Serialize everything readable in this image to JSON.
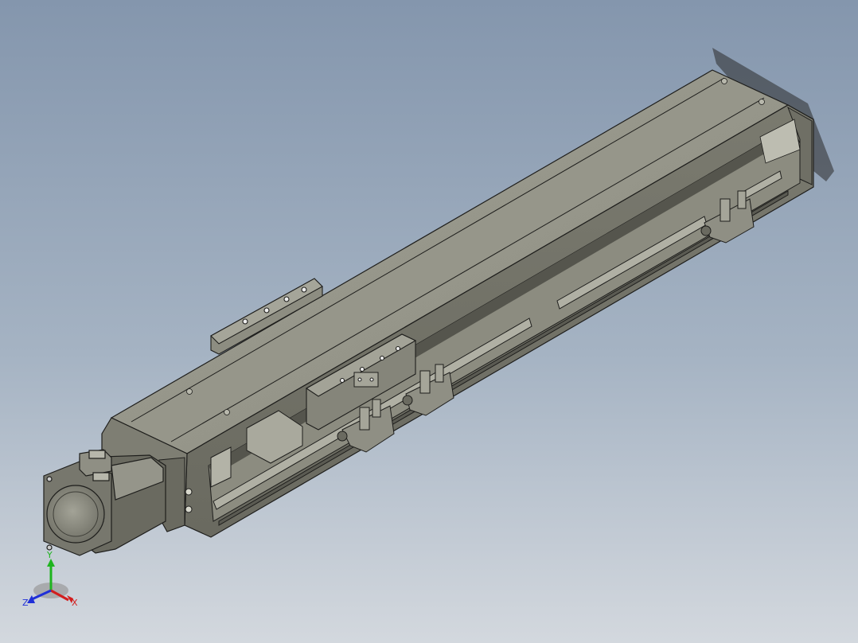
{
  "viewport": {
    "background_top": "#8496ad",
    "background_bottom": "#d3d8de"
  },
  "model": {
    "body_color": "#8a8a7e",
    "body_dark": "#5f5f56",
    "body_light": "#b7b7ab",
    "edge_color": "#1e1e1c",
    "icon": "cad-assembly-linear-actuator"
  },
  "triad": {
    "x_label": "X",
    "y_label": "Y",
    "z_label": "Z",
    "x_color": "#d21e1e",
    "y_color": "#1eb41e",
    "z_color": "#2030d8"
  }
}
